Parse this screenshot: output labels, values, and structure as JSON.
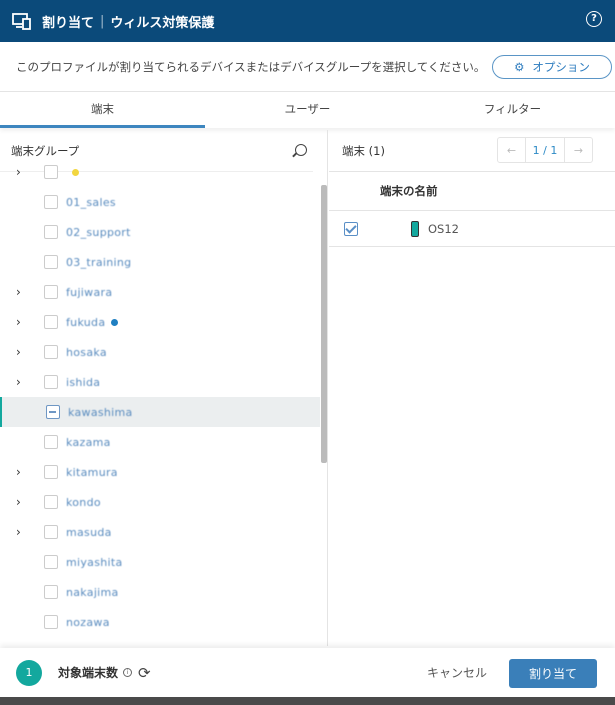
{
  "header": {
    "title": "割り当て",
    "subtitle": "ウィルス対策保護",
    "help_icon": "question-circle-icon",
    "color": "#0b4a7a"
  },
  "instruction": "このプロファイルが割り当てられるデバイスまたはデバイスグループを選択してください。",
  "options_button": "オプション",
  "tabs": [
    {
      "label": "端末",
      "active": true
    },
    {
      "label": "ユーザー"
    },
    {
      "label": "フィルター"
    }
  ],
  "group_panel": {
    "title": "端末グループ",
    "items": [
      {
        "name": "",
        "expandable": true,
        "dot": "#f2d640"
      },
      {
        "name": "01_sales"
      },
      {
        "name": "02_support"
      },
      {
        "name": "03_training"
      },
      {
        "name": "fujiwara",
        "expandable": true
      },
      {
        "name": "fukuda",
        "expandable": true,
        "dot": "#1f7fc1"
      },
      {
        "name": "hosaka",
        "expandable": true
      },
      {
        "name": "ishida",
        "expandable": true
      },
      {
        "name": "kawashima",
        "selected": true,
        "indeterminate": true
      },
      {
        "name": "kazama"
      },
      {
        "name": "kitamura",
        "expandable": true
      },
      {
        "name": "kondo",
        "expandable": true
      },
      {
        "name": "masuda",
        "expandable": true
      },
      {
        "name": "miyashita"
      },
      {
        "name": "nakajima"
      },
      {
        "name": "nozawa"
      }
    ]
  },
  "device_panel": {
    "title": "端末 (1)",
    "pager": "1 / 1",
    "column": "端末の名前",
    "devices": [
      {
        "name": "OS12",
        "checked": true
      }
    ]
  },
  "footer": {
    "count": "1",
    "label": "対象端末数",
    "cancel": "キャンセル",
    "assign": "割り当て"
  },
  "colors": {
    "accent": "#13a89e",
    "primary": "#3a7fb9"
  }
}
